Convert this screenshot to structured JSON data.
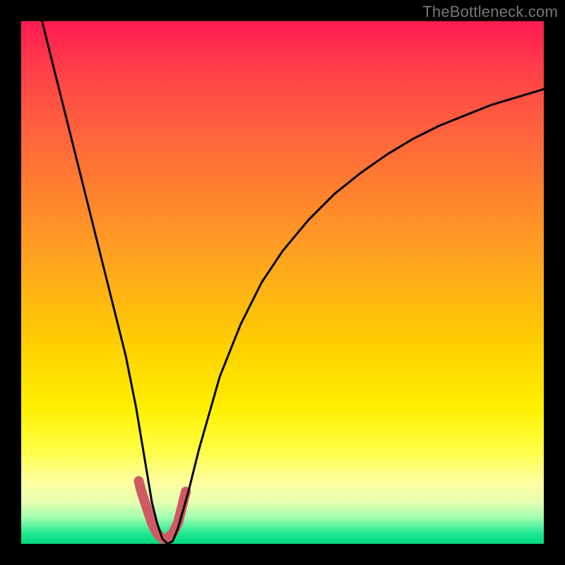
{
  "watermark": "TheBottleneck.com",
  "chart_data": {
    "type": "line",
    "title": "",
    "xlabel": "",
    "ylabel": "",
    "xlim": [
      0,
      100
    ],
    "ylim": [
      0,
      100
    ],
    "series": [
      {
        "name": "bottleneck-curve",
        "x": [
          4,
          6,
          8,
          10,
          12,
          14,
          16,
          18,
          20,
          22,
          24,
          25,
          26,
          27,
          28,
          29,
          30,
          32,
          34,
          38,
          42,
          46,
          50,
          55,
          60,
          65,
          70,
          75,
          80,
          85,
          90,
          95,
          100
        ],
        "values": [
          100,
          92,
          84,
          76,
          68,
          60,
          52,
          44,
          36,
          26,
          14,
          8,
          4,
          1,
          0,
          0.5,
          3,
          10,
          18,
          32,
          42,
          50,
          56,
          62,
          67,
          71,
          74.5,
          77.5,
          80,
          82,
          84,
          85.5,
          87
        ]
      }
    ],
    "highlight": {
      "name": "optimal-range",
      "x": [
        22.5,
        23,
        24,
        25,
        26,
        27,
        28,
        29,
        30,
        30.5,
        31,
        31.5
      ],
      "values": [
        12,
        10,
        7,
        4,
        2,
        1,
        1,
        2,
        4,
        6,
        8,
        10
      ],
      "color": "#cf5a63",
      "stroke_width_relative": 14
    },
    "colors": {
      "curve": "#000000",
      "highlight": "#cf5a63",
      "gradient_top": "#ff1a52",
      "gradient_bottom": "#00d980"
    }
  }
}
